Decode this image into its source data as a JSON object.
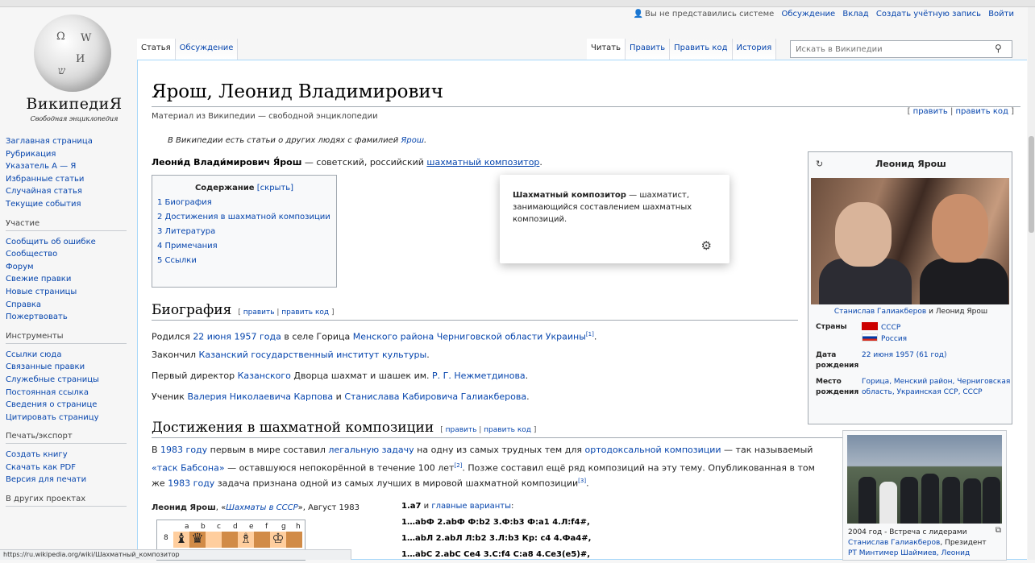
{
  "logo": {
    "wordmark": "ВикипедиЯ",
    "tagline": "Свободная энциклопедия",
    "glyphs": [
      "Ω",
      "W",
      "И",
      "ש"
    ]
  },
  "personal": {
    "not_logged": "Вы не представились системе",
    "talk": "Обсуждение",
    "contributions": "Вклад",
    "create_account": "Создать учётную запись",
    "login": "Войти"
  },
  "tabs": {
    "article": "Статья",
    "discussion": "Обсуждение",
    "read": "Читать",
    "edit": "Править",
    "edit_source": "Править код",
    "history": "История"
  },
  "search": {
    "placeholder": "Искать в Википедии"
  },
  "sidebar": {
    "main": [
      "Заглавная страница",
      "Рубрикация",
      "Указатель А — Я",
      "Избранные статьи",
      "Случайная статья",
      "Текущие события"
    ],
    "participation_title": "Участие",
    "participation": [
      "Сообщить об ошибке",
      "Сообщество",
      "Форум",
      "Свежие правки",
      "Новые страницы",
      "Справка",
      "Пожертвовать"
    ],
    "tools_title": "Инструменты",
    "tools": [
      "Ссылки сюда",
      "Связанные правки",
      "Служебные страницы",
      "Постоянная ссылка",
      "Сведения о странице",
      "Цитировать страницу"
    ],
    "print_title": "Печать/экспорт",
    "print": [
      "Создать книгу",
      "Скачать как PDF",
      "Версия для печати"
    ],
    "other_title": "В других проектах"
  },
  "article": {
    "title": "Ярош, Леонид Владимирович",
    "sitesub": "Материал из Википедии — свободной энциклопедии",
    "edit_open": "[ ",
    "edit": "править",
    "edit_sep": " | ",
    "edit_source": "править код",
    "edit_close": " ]",
    "hatnote_prefix": "В Википедии есть статьи о других людях с фамилией ",
    "hatnote_link": "Ярош",
    "hatnote_suffix": ".",
    "lead_bold": "Леони́д Влади́мирович Я́рош",
    "lead_text": " — советский, российский ",
    "lead_link": "шахматный композитор",
    "lead_end": "."
  },
  "toc": {
    "title": "Содержание",
    "hide": "[скрыть]",
    "items": [
      "1 Биография",
      "2 Достижения в шахматной композиции",
      "3 Литература",
      "4 Примечания",
      "5 Ссылки"
    ]
  },
  "popup": {
    "bold": "Шахматный композитор",
    "text": " — шахматист, занимающийся составлением шахматных композиций."
  },
  "biography": {
    "heading": "Биография",
    "p1": [
      "Родился ",
      "22 июня",
      " ",
      "1957 года",
      " в селе Горица ",
      "Менского района",
      " ",
      "Черниговской области",
      " ",
      "Украины",
      "[1]",
      "."
    ],
    "p2": [
      "Закончил ",
      "Казанский государственный институт культуры",
      "."
    ],
    "p3": [
      "Первый директор ",
      "Казанского",
      " Дворца шахмат и шашек им. ",
      "Р. Г. Нежметдинова",
      "."
    ],
    "p4": [
      "Ученик ",
      "Валерия Николаевича Карпова",
      " и ",
      "Станислава Кабировича Галиакберова",
      "."
    ]
  },
  "achievements": {
    "heading": "Достижения в шахматной композиции",
    "l1": [
      "В ",
      "1983 году",
      " первым в мире составил ",
      "легальную задачу",
      " на одну из самых трудных тем для ",
      "ортодоксальной композиции",
      " — так называемый"
    ],
    "l2": [
      "«таск Бабсона»",
      " — оставшуюся непокорённой в течение 100 лет",
      "[2]",
      ". Позже составил ещё ряд композиций на эту тему. Опубликованная в том"
    ],
    "l3": [
      "же ",
      "1983 году",
      " задача признана одной из самых лучших в мировой шахматной композиции",
      "[3]",
      "."
    ]
  },
  "chess": {
    "author": "Леонид Ярош",
    "sep": ", «",
    "magazine": "Шахматы в СССР",
    "date": "», Август 1983",
    "files": [
      "a",
      "b",
      "c",
      "d",
      "e",
      "f",
      "g",
      "h"
    ],
    "rank": "8",
    "moves_first": "1.a7",
    "moves_and": " и ",
    "moves_link": "главные варианты",
    "moves_colon": ":",
    "lines": [
      "1…abФ 2.abФ Ф:b2 3.Ф:b3 Ф:a1 4.Л:f4#,",
      "1…abЛ 2.abЛ Л:b2 3.Л:b3 Кр: c4 4.Фa4#,",
      "1…abC 2.abC Ce4 3.C:f4 C:a8 4.Ce3(e5)#,"
    ]
  },
  "infobox": {
    "title": "Леонид Ярош",
    "edit_icon": "↻",
    "caption": [
      "Станислав Галиакберов",
      " и ",
      "Леонид Ярош"
    ],
    "countries_label": "Страны",
    "countries": [
      "СССР",
      "Россия"
    ],
    "birthdate_label": "Дата рождения",
    "birthdate": "22 июня 1957 (61 год)",
    "birthplace_label": "Место рождения",
    "birthplace": "Горица, Менский район, Черниговская область, Украинская ССР, СССР"
  },
  "thumb": {
    "caption_prefix": "2004 год - Встреча с лидерами",
    "caption_link1": "Станислав Галиакберов",
    "caption_mid": ", Президент",
    "caption_line3": "РТ Минтимер Шаймиев, Леонид"
  },
  "statusbar": {
    "url": "https://ru.wikipedia.org/wiki/Шахматный_композитор"
  },
  "colors": {
    "link": "#0645ad",
    "board_dark": "#d18b47",
    "board_light": "#ffce9e"
  }
}
